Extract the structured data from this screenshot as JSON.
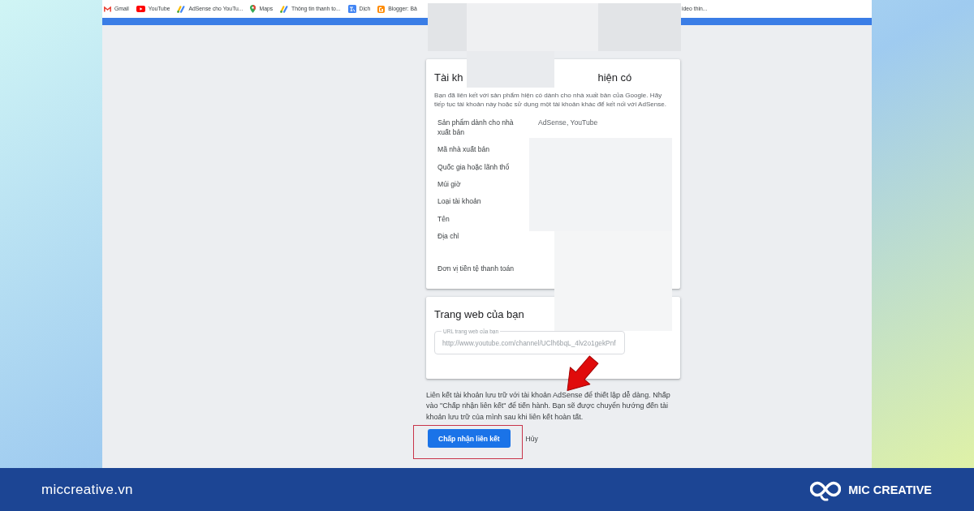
{
  "bookmarks": [
    {
      "kind": "mail",
      "label": "Gmail"
    },
    {
      "kind": "video",
      "label": "YouTube"
    },
    {
      "kind": "bars",
      "label": "AdSense cho YouTu..."
    },
    {
      "kind": "pin",
      "label": "Maps"
    },
    {
      "kind": "bars",
      "label": "Thông tin thanh to..."
    },
    {
      "kind": "translate",
      "label": "Dịch"
    },
    {
      "kind": "tile",
      "label": "Blogger: Bả"
    }
  ],
  "bookmark_fragment": "ideo thin...",
  "account_card": {
    "title_parts": [
      "Tài kh",
      "hiện có"
    ],
    "description": "Bạn đã liên kết với sản phẩm hiện có dành cho nhà xuất bản của Google. Hãy tiếp tục tài khoản này hoặc sử dụng một tài khoản khác để kết nối với AdSense.",
    "rows": [
      {
        "kind": "single",
        "label": "Sản phẩm dành cho nhà xuất bản",
        "value": "AdSense, YouTube"
      },
      {
        "kind": "single",
        "label": "Mã nhà xuất bản"
      },
      {
        "kind": "single",
        "label": "Quốc gia hoặc lãnh thổ"
      },
      {
        "kind": "single",
        "label": "Múi giờ"
      },
      {
        "kind": "single",
        "label": "Loại tài khoản"
      },
      {
        "kind": "single",
        "label": "Tên"
      },
      {
        "kind": "multiline",
        "label": "Địa chỉ"
      },
      {
        "kind": "single",
        "label": "Đơn vị tiền tệ thanh toán"
      }
    ]
  },
  "website_card": {
    "title": "Trang web của bạn",
    "url_field": {
      "label": "URL trang web của bạn",
      "value": "http://www.youtube.com/channel/UClh6bqL_4lv2o1gekPnf"
    }
  },
  "link_note": "Liên kết tài khoản lưu trữ với tài khoản AdSense để thiết lập dễ dàng. Nhấp vào \"Chấp nhận liên kết\" để tiến hành. Bạn sẽ được chuyển hướng đến tài khoản lưu trữ của mình sau khi liên kết hoàn tất.",
  "actions": [
    {
      "kind": "primary",
      "label": "Chấp nhận liên kết"
    },
    {
      "kind": "text",
      "label": "Hủy"
    }
  ],
  "footer": {
    "site": "miccreative.vn",
    "brand": "MIC CREATIVE"
  }
}
